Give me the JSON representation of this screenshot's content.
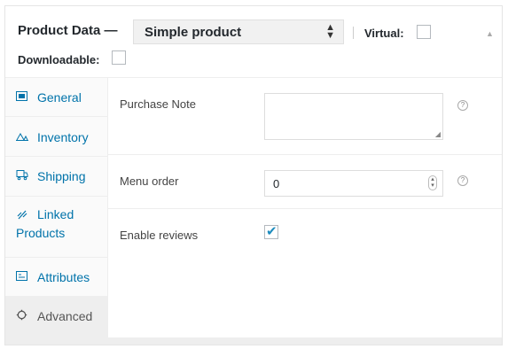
{
  "header": {
    "title": "Product Data —",
    "product_type": "Simple product",
    "virtual_label": "Virtual:",
    "downloadable_label": "Downloadable:"
  },
  "tabs": [
    {
      "label": "General",
      "icon": "general-icon",
      "active": false
    },
    {
      "label": "Inventory",
      "icon": "inventory-icon",
      "active": false
    },
    {
      "label": "Shipping",
      "icon": "shipping-icon",
      "active": false
    },
    {
      "label": "Linked",
      "label2": "Products",
      "icon": "linked-products-icon",
      "active": false
    },
    {
      "label": "Attributes",
      "icon": "attributes-icon",
      "active": false
    },
    {
      "label": "Advanced",
      "icon": "advanced-icon",
      "active": true
    }
  ],
  "fields": {
    "purchase_note": {
      "label": "Purchase Note",
      "value": ""
    },
    "menu_order": {
      "label": "Menu order",
      "value": "0"
    },
    "enable_reviews": {
      "label": "Enable reviews",
      "checked": true
    }
  },
  "colors": {
    "link": "#0073aa",
    "active_tab_bg": "#eeeeee",
    "checkbox_check": "#1e8cbe"
  }
}
